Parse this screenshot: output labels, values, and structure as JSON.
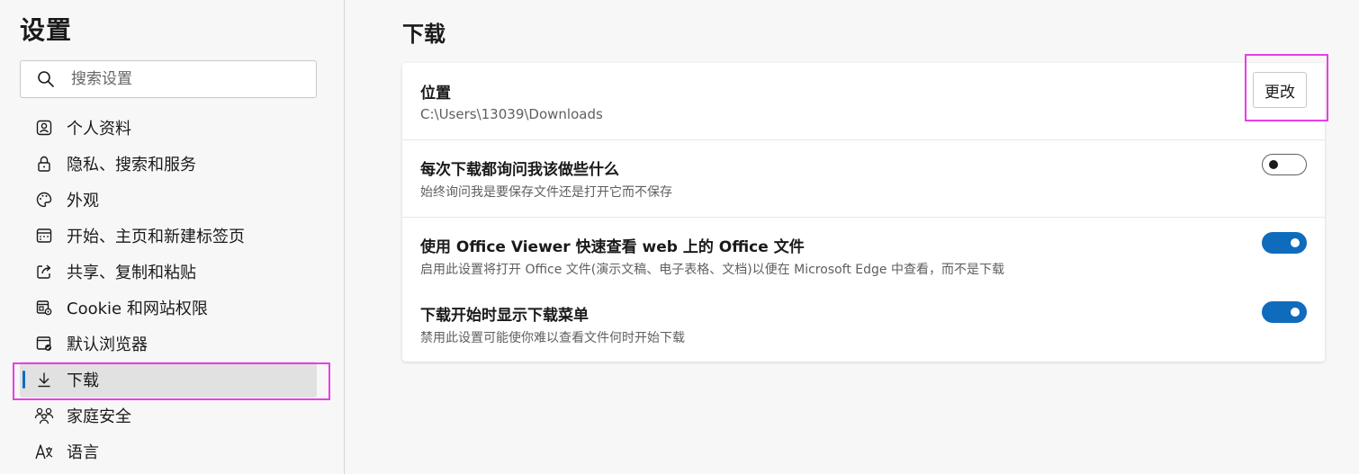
{
  "sidebar": {
    "title": "设置",
    "search": {
      "placeholder": "搜索设置",
      "icon": "search-icon"
    },
    "items": [
      {
        "label": "个人资料",
        "icon": "profile-icon",
        "active": false
      },
      {
        "label": "隐私、搜索和服务",
        "icon": "lock-icon",
        "active": false
      },
      {
        "label": "外观",
        "icon": "palette-icon",
        "active": false
      },
      {
        "label": "开始、主页和新建标签页",
        "icon": "home-tab-icon",
        "active": false
      },
      {
        "label": "共享、复制和粘贴",
        "icon": "share-icon",
        "active": false
      },
      {
        "label": "Cookie 和网站权限",
        "icon": "site-permissions-icon",
        "active": false
      },
      {
        "label": "默认浏览器",
        "icon": "default-browser-icon",
        "active": false
      },
      {
        "label": "下载",
        "icon": "download-icon",
        "active": true
      },
      {
        "label": "家庭安全",
        "icon": "family-icon",
        "active": false
      },
      {
        "label": "语言",
        "icon": "language-icon",
        "active": false
      }
    ]
  },
  "main": {
    "title": "下载",
    "location": {
      "title": "位置",
      "path": "C:\\Users\\13039\\Downloads",
      "button_label": "更改"
    },
    "ask_each_download": {
      "title": "每次下载都询问我该做些什么",
      "description": "始终询问我是要保存文件还是打开它而不保存",
      "enabled": false
    },
    "office_viewer": {
      "title": "使用 Office Viewer 快速查看 web 上的 Office 文件",
      "description": "启用此设置将打开 Office 文件(演示文稿、电子表格、文档)以便在 Microsoft Edge 中查看，而不是下载",
      "enabled": true
    },
    "show_downloads_menu": {
      "title": "下载开始时显示下载菜单",
      "description": "禁用此设置可能使你难以查看文件何时开始下载",
      "enabled": true
    }
  },
  "colors": {
    "accent": "#0f6cbd",
    "highlight": "#e83fe8"
  }
}
